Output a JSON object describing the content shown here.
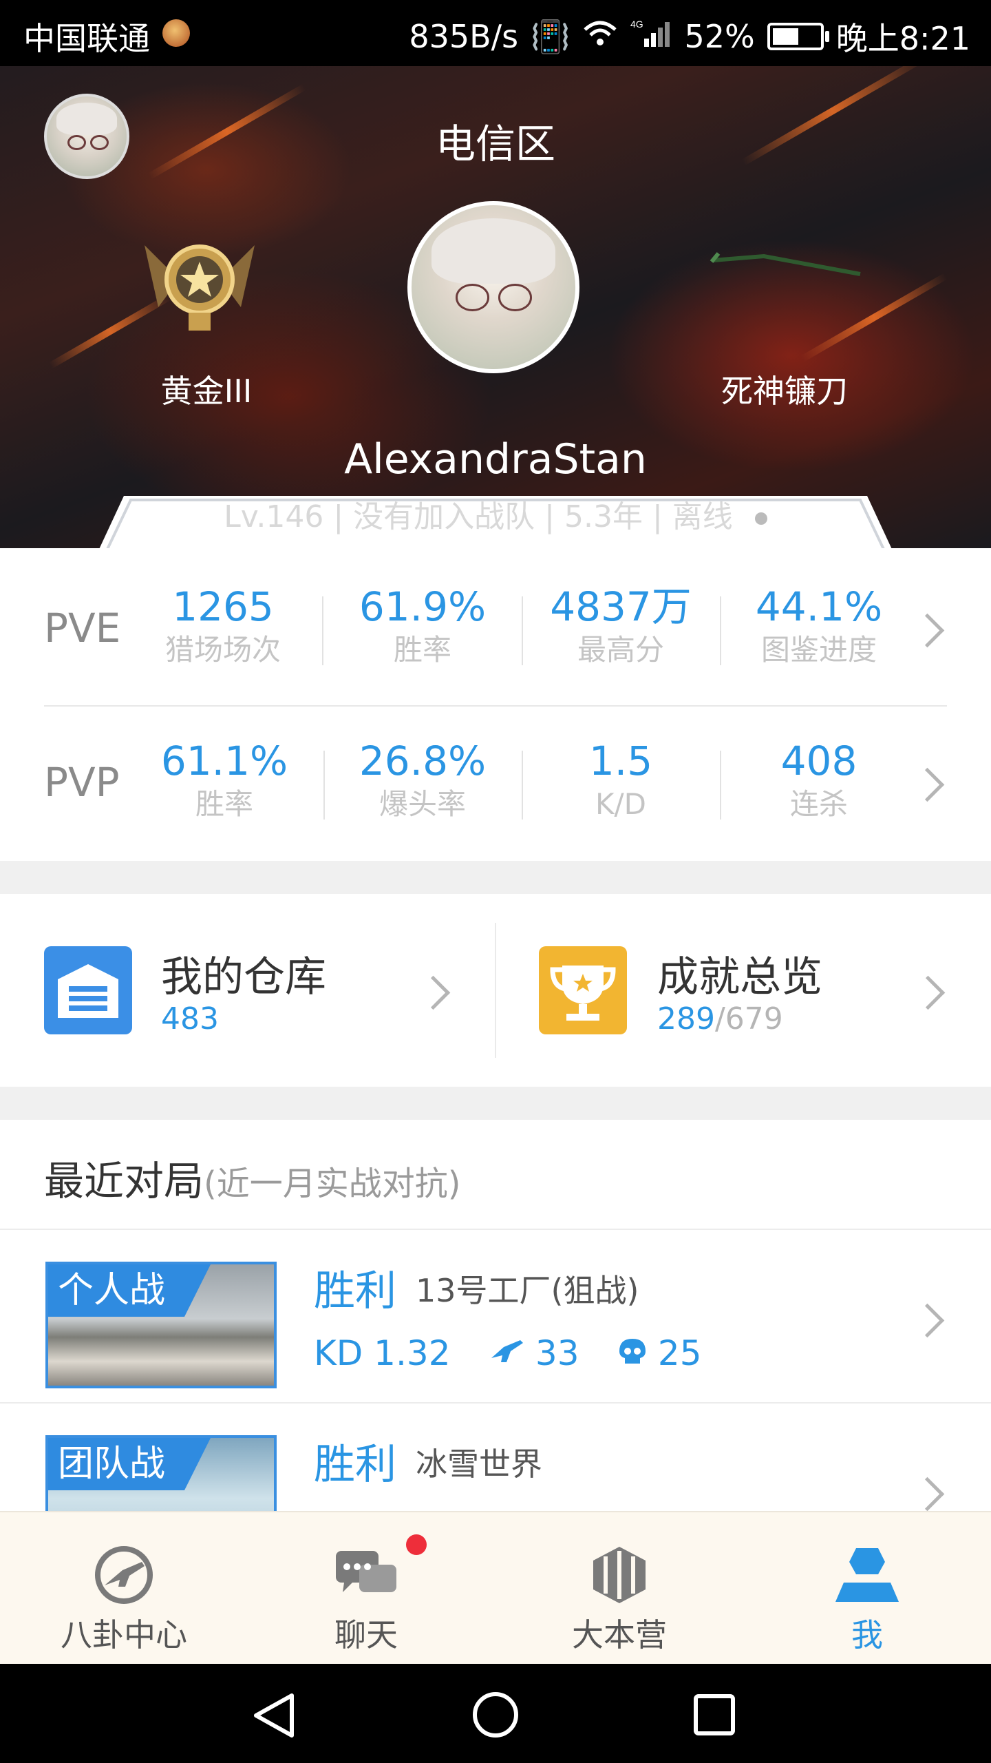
{
  "status_bar": {
    "carrier": "中国联通",
    "speed": "835B/s",
    "network": "4G",
    "battery": "52%",
    "time": "晚上8:21"
  },
  "profile": {
    "server": "电信区",
    "rank": "黄金III",
    "weapon": "死神镰刀",
    "username": "AlexandraStan",
    "level": "Lv.146",
    "team": "没有加入战队",
    "years": "5.3年",
    "status": "离线"
  },
  "pve": {
    "label": "PVE",
    "stats": [
      {
        "value": "1265",
        "label": "猎场场次"
      },
      {
        "value": "61.9%",
        "label": "胜率"
      },
      {
        "value": "4837万",
        "label": "最高分"
      },
      {
        "value": "44.1%",
        "label": "图鉴进度"
      }
    ]
  },
  "pvp": {
    "label": "PVP",
    "stats": [
      {
        "value": "61.1%",
        "label": "胜率"
      },
      {
        "value": "26.8%",
        "label": "爆头率"
      },
      {
        "value": "1.5",
        "label": "K/D"
      },
      {
        "value": "408",
        "label": "连杀"
      }
    ]
  },
  "shortcuts": {
    "warehouse": {
      "title": "我的仓库",
      "count": "483",
      "color": "#3b8fe6"
    },
    "achievements": {
      "title": "成就总览",
      "count": "289",
      "total": "/679",
      "color": "#f2b531"
    }
  },
  "recent": {
    "title": "最近对局",
    "subtitle": "(近一月实战对抗)",
    "matches": [
      {
        "mode": "个人战",
        "result": "胜利",
        "map": "13号工厂(狙战)",
        "kd": "KD 1.32",
        "kills": "33",
        "deaths": "25"
      },
      {
        "mode": "团队战",
        "result": "胜利",
        "map": "冰雪世界"
      }
    ]
  },
  "bottom_nav": {
    "items": [
      {
        "label": "八卦中心",
        "icon": "gun-circle-icon"
      },
      {
        "label": "聊天",
        "icon": "chat-bubbles-icon"
      },
      {
        "label": "大本营",
        "icon": "base-hexagon-icon"
      },
      {
        "label": "我",
        "icon": "me-person-icon"
      }
    ],
    "active_color": "#2a95e3",
    "badge_color": "#ee2e3a"
  }
}
